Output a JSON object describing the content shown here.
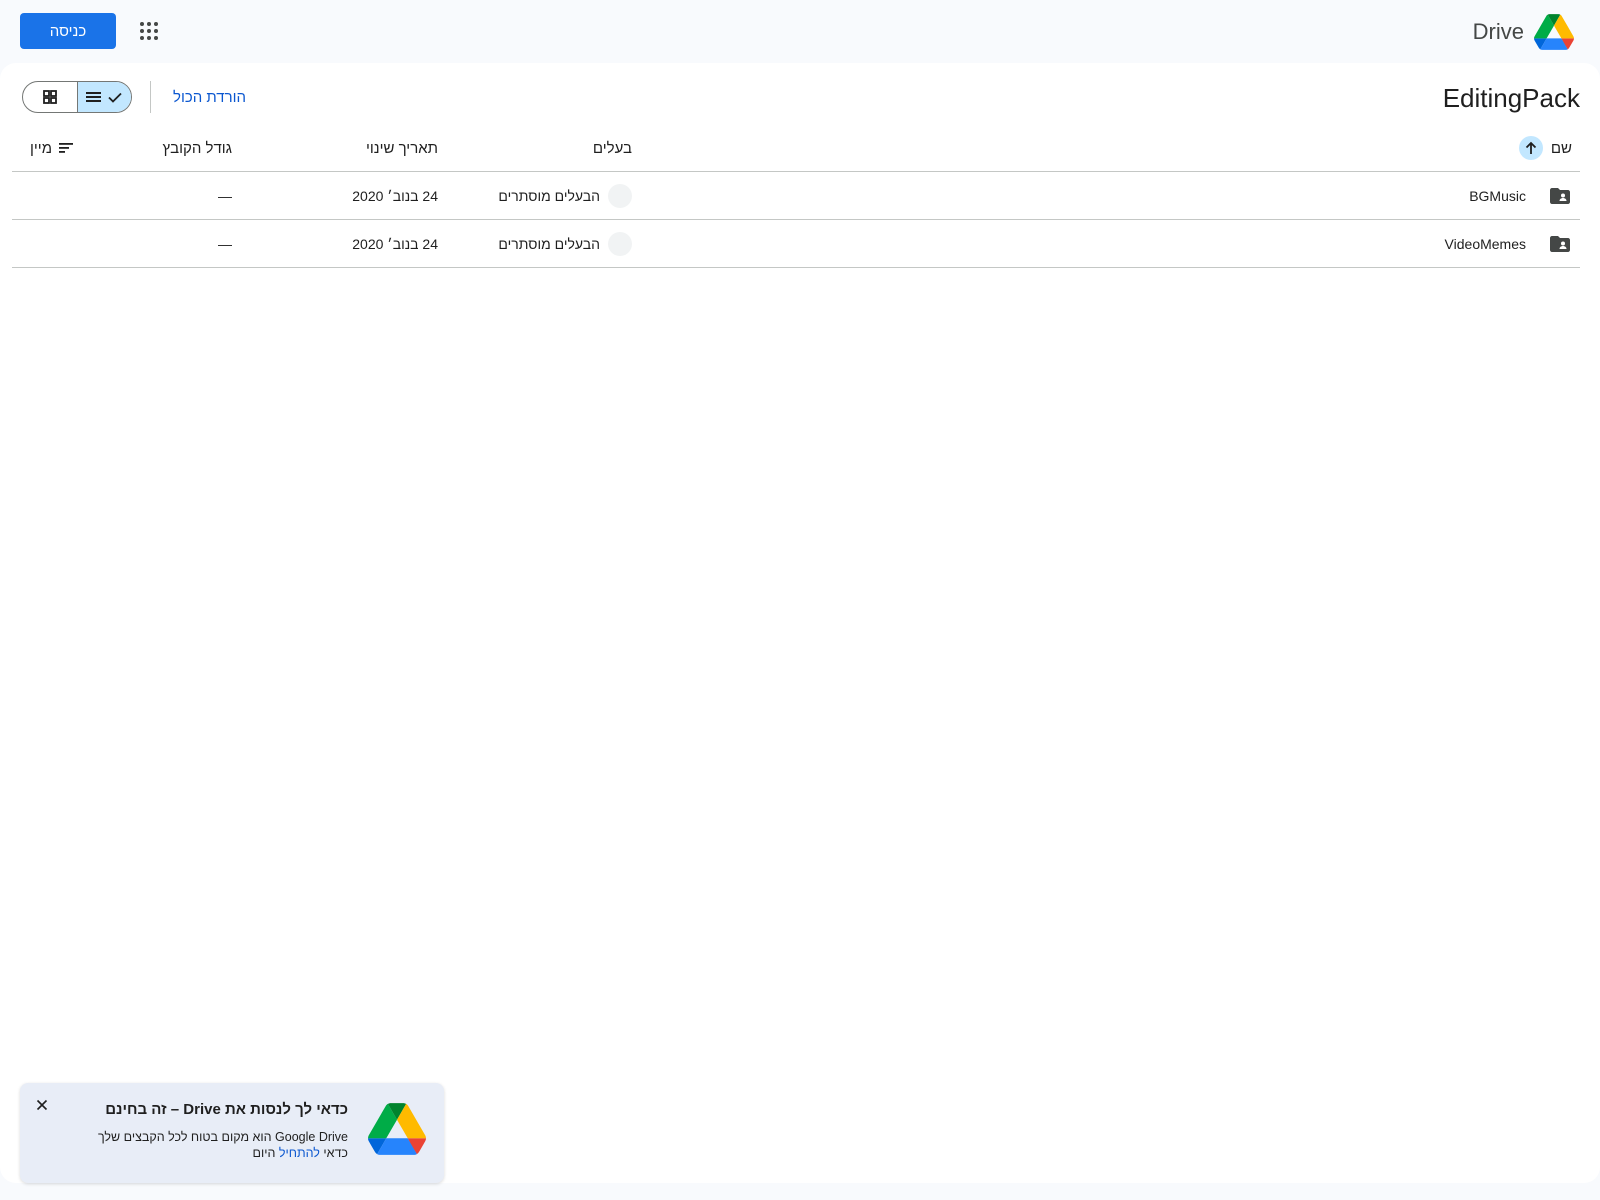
{
  "header": {
    "brand_name": "Drive",
    "signin_label": "כניסה"
  },
  "folder": {
    "title": "EditingPack",
    "download_all_label": "הורדת הכול"
  },
  "table": {
    "columns": {
      "name": "שם",
      "owner": "בעלים",
      "modified": "תאריך שינוי",
      "size": "גודל הקובץ",
      "sort": "מיין"
    },
    "rows": [
      {
        "name": "BGMusic",
        "owner": "הבעלים מוסתרים",
        "modified": "24 בנוב׳ 2020",
        "size": "—"
      },
      {
        "name": "VideoMemes",
        "owner": "הבעלים מוסתרים",
        "modified": "24 בנוב׳ 2020",
        "size": "—"
      }
    ]
  },
  "promo": {
    "title": "כדאי לך לנסות את Drive – זה בחינם",
    "body_line1": "Google Drive הוא מקום בטוח לכל הקבצים שלך",
    "body_line2_prefix": "כדאי ",
    "body_link": "להתחיל",
    "body_line2_suffix": " היום"
  },
  "icons": {
    "brand": "drive-logo-icon",
    "apps": "apps-grid-icon",
    "grid_view": "grid-view-icon",
    "list_view": "list-view-icon",
    "sort_direction": "arrow-up-icon",
    "folder": "shared-folder-icon",
    "sort_options": "sort-lines-icon",
    "close": "close-icon"
  },
  "colors": {
    "accent": "#1a73e8",
    "link": "#0b57d0",
    "selected": "#c2e7ff"
  }
}
